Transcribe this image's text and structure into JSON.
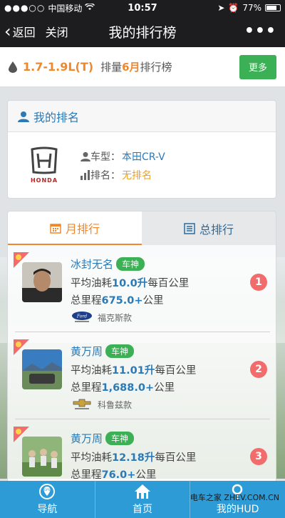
{
  "status": {
    "carrier": "中国移动",
    "time": "10:57",
    "battery": "77%"
  },
  "nav": {
    "back_label": "返回",
    "close_label": "关闭",
    "title": "我的排行榜",
    "more": "•••"
  },
  "filter": {
    "range": "1.7-1.9L(T)",
    "caption_pre": "排量",
    "month": "6月",
    "caption_post": "排行榜",
    "more_button": "更多"
  },
  "my_rank": {
    "title": "我的排名",
    "brand_logo_text": "HONDA",
    "model_label": "车型：",
    "model_value": "本田CR-V",
    "rank_label": "排名：",
    "rank_value": "无排名"
  },
  "tabs": [
    {
      "label": "月排行",
      "active": true
    },
    {
      "label": "总排行",
      "active": false
    }
  ],
  "list": [
    {
      "name": "冰封无名",
      "tag": "车神",
      "fuel_pre": "平均油耗",
      "fuel_value": "10.0升",
      "fuel_post": "每百公里",
      "dist_pre": "总里程",
      "dist_value": "675.0+",
      "dist_post": "公里",
      "car": "福克斯款",
      "rank": "1"
    },
    {
      "name": "黄万周",
      "tag": "车神",
      "fuel_pre": "平均油耗",
      "fuel_value": "11.01升",
      "fuel_post": "每百公里",
      "dist_pre": "总里程",
      "dist_value": "1,688.0+",
      "dist_post": "公里",
      "car": "科鲁兹款",
      "rank": "2"
    },
    {
      "name": "黄万周",
      "tag": "车神",
      "fuel_pre": "平均油耗",
      "fuel_value": "12.18升",
      "fuel_post": "每百公里",
      "dist_pre": "总里程",
      "dist_value": "76.0+",
      "dist_post": "公里",
      "car": "",
      "rank": "3"
    }
  ],
  "bottom_nav": [
    {
      "label": "导航",
      "icon": "gps-icon"
    },
    {
      "label": "首页",
      "icon": "home-icon"
    },
    {
      "label": "我的HUD",
      "icon": "search-icon"
    }
  ],
  "watermark": "电车之家 ZHEV.COM.CN",
  "colors": {
    "accent_orange": "#f0882b",
    "accent_blue": "#2a7ab8",
    "green": "#3cb054",
    "bottom_bar": "#2d9bd5"
  }
}
